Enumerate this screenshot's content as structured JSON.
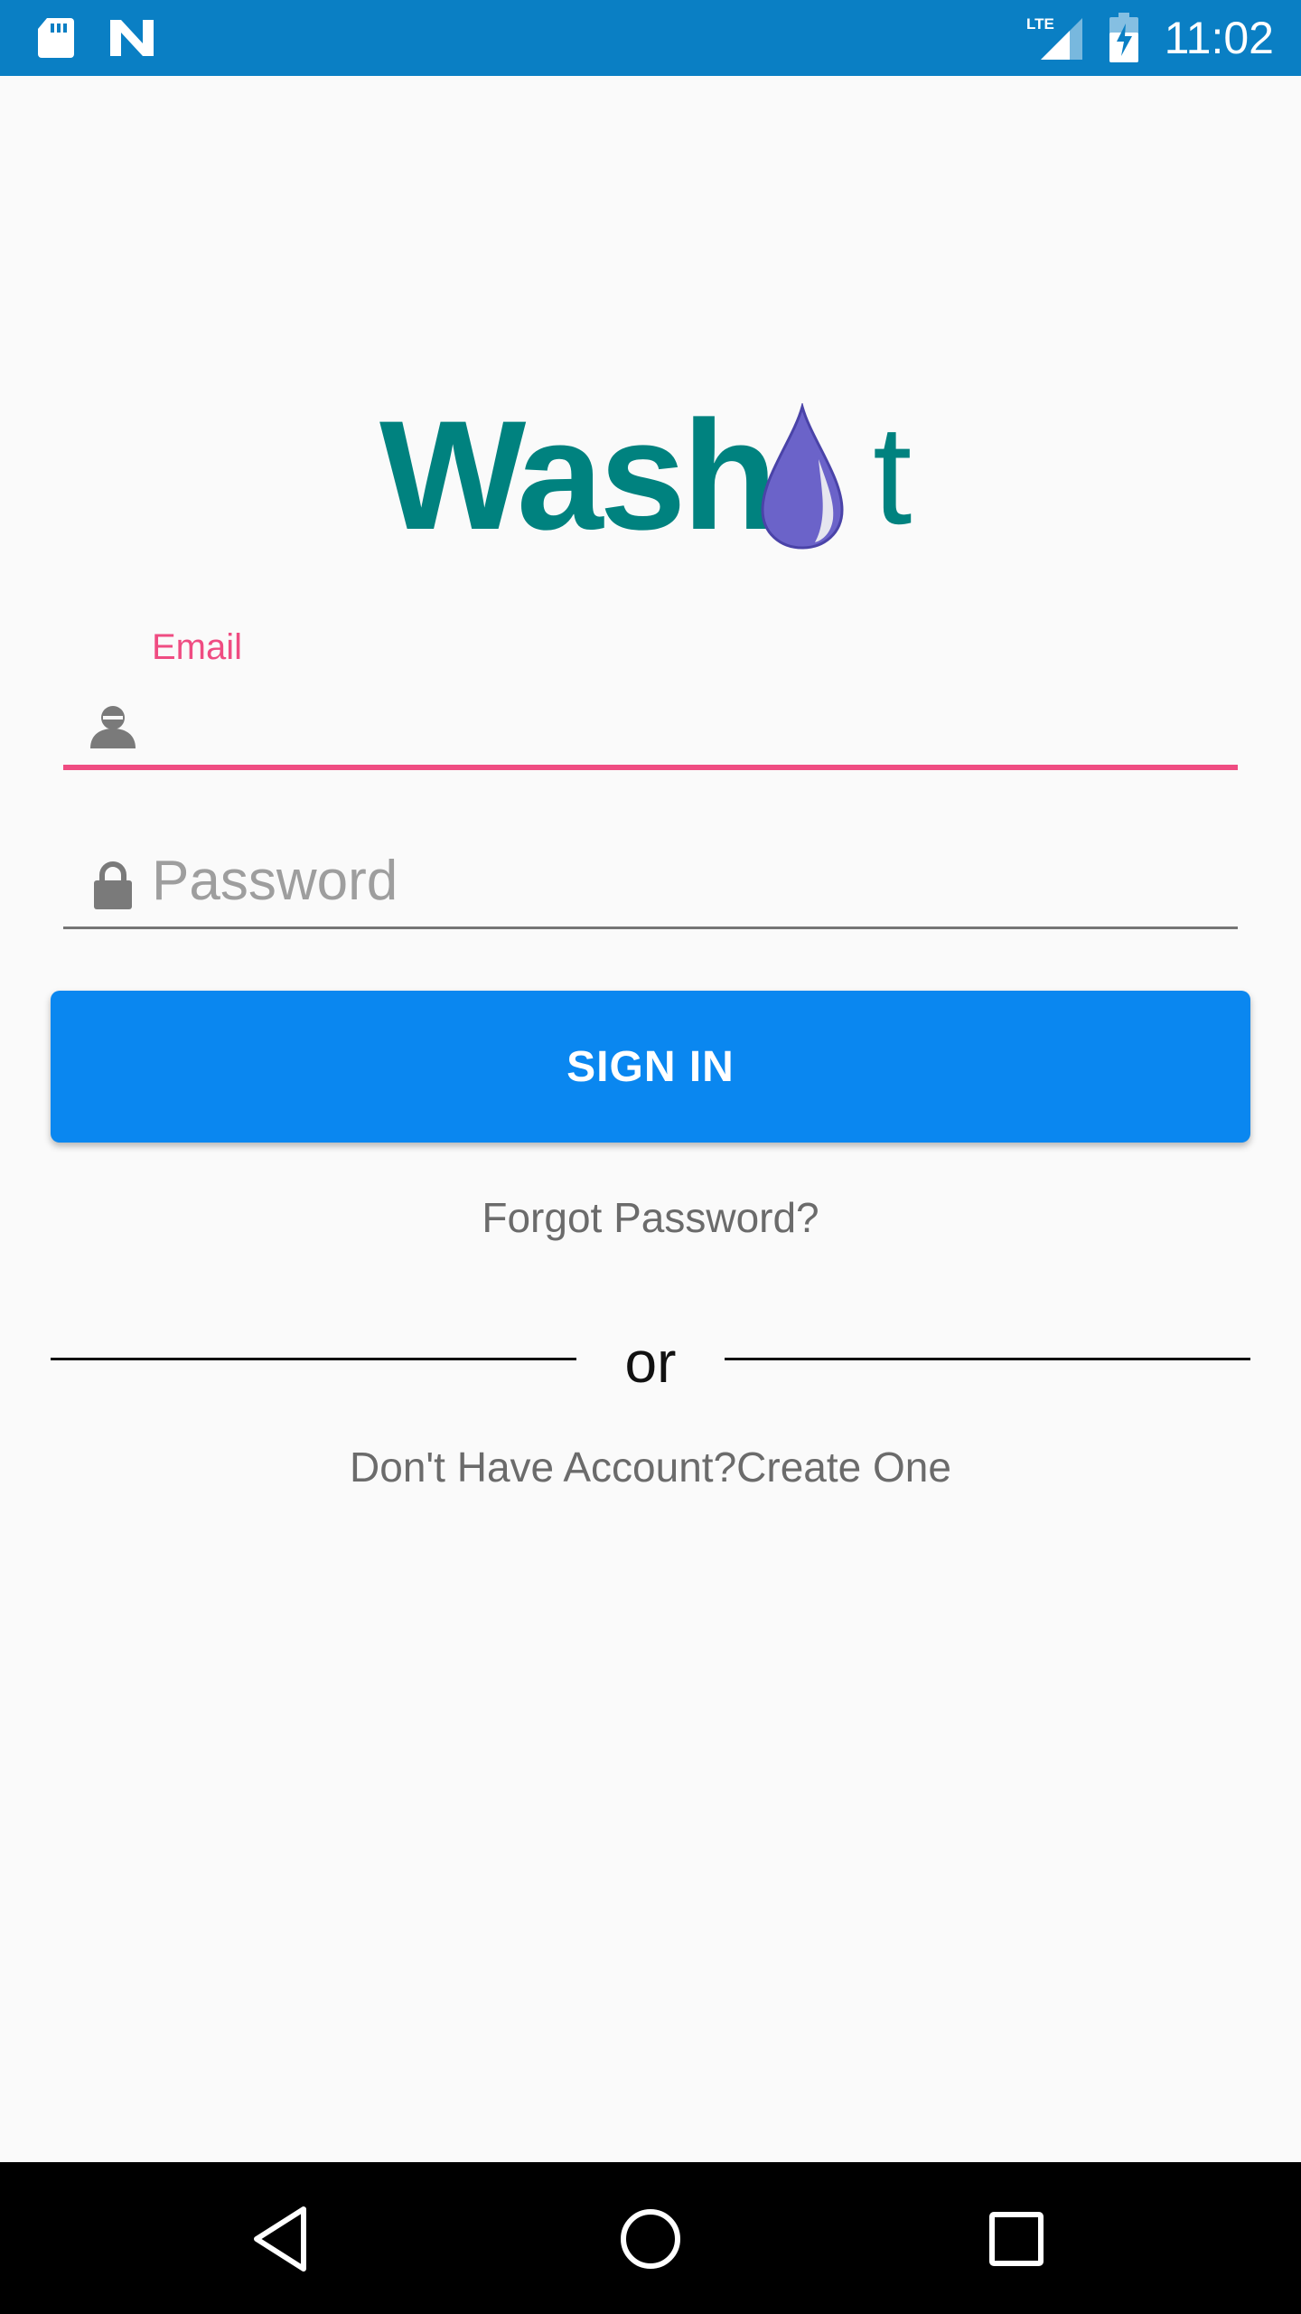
{
  "status_bar": {
    "time": "11:02",
    "icons": [
      "sd-card-icon",
      "n-notification-icon",
      "lte-signal-icon",
      "battery-charging-icon"
    ]
  },
  "logo": {
    "text_before": "Wash",
    "text_after": "t",
    "drop_color": "#6b63c9",
    "text_color": "#00827f"
  },
  "form": {
    "email_label": "Email",
    "email_value": "",
    "password_placeholder": "Password",
    "password_value": "",
    "signin_label": "SIGN IN",
    "forgot_label": "Forgot Password?",
    "or_label": "or",
    "create_account_label": "Don't Have Account?Create One"
  },
  "colors": {
    "status_bar": "#0a7fc4",
    "accent": "#ef4c82",
    "button": "#0a87f0"
  },
  "nav_bar": {
    "buttons": [
      "back-icon",
      "home-icon",
      "recents-icon"
    ]
  }
}
